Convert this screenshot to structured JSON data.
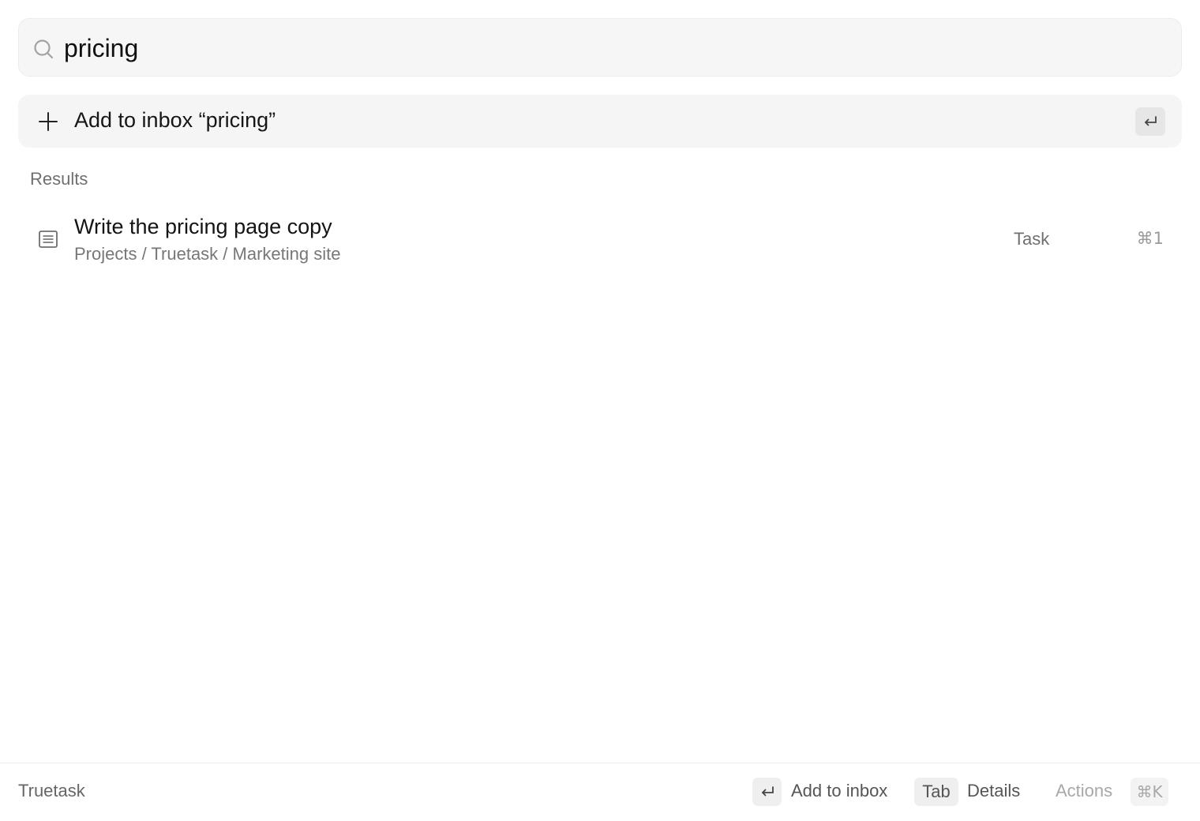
{
  "search": {
    "value": "pricing",
    "icon": "search-icon"
  },
  "add_action": {
    "prefix": "Add to inbox",
    "query": "“pricing”",
    "icon": "plus-icon",
    "shortcut_icon": "return-key-icon"
  },
  "results": {
    "section_label": "Results",
    "items": [
      {
        "title": "Write the pricing page copy",
        "path": "Projects / Truetask / Marketing site",
        "type": "Task",
        "shortcut": "⌘1",
        "icon": "document-icon"
      }
    ]
  },
  "footer": {
    "brand": "Truetask",
    "primary_action_label": "Add to inbox",
    "tab_key": "Tab",
    "tab_action_label": "Details",
    "actions_label": "Actions",
    "actions_shortcut": "⌘K"
  },
  "colors": {
    "background": "#ffffff",
    "panel": "#f6f6f6",
    "key_cap": "#e6e6e6",
    "muted_text": "#6f6f6f"
  }
}
